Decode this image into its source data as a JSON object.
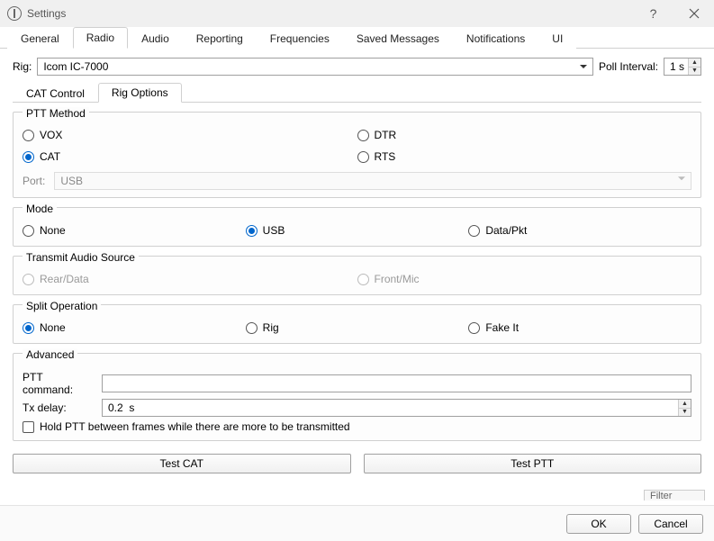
{
  "window": {
    "title": "Settings",
    "help_glyph": "?",
    "close_glyph": "✕"
  },
  "main_tabs": [
    "General",
    "Radio",
    "Audio",
    "Reporting",
    "Frequencies",
    "Saved Messages",
    "Notifications",
    "UI"
  ],
  "main_tab_active": 1,
  "rig": {
    "label": "Rig:",
    "value": "Icom IC-7000",
    "poll_label": "Poll Interval:",
    "poll_value": "1 s"
  },
  "sub_tabs": [
    "CAT Control",
    "Rig Options"
  ],
  "sub_tab_active": 1,
  "ptt_method": {
    "title": "PTT Method",
    "options": {
      "vox": "VOX",
      "cat": "CAT",
      "dtr": "DTR",
      "rts": "RTS"
    },
    "selected": "cat",
    "port_label": "Port:",
    "port_value": "USB"
  },
  "mode": {
    "title": "Mode",
    "options": {
      "none": "None",
      "usb": "USB",
      "data": "Data/Pkt"
    },
    "selected": "usb"
  },
  "tx_audio": {
    "title": "Transmit Audio Source",
    "options": {
      "rear": "Rear/Data",
      "front": "Front/Mic"
    },
    "enabled": false
  },
  "split": {
    "title": "Split Operation",
    "options": {
      "none": "None",
      "rig": "Rig",
      "fake": "Fake It"
    },
    "selected": "none"
  },
  "advanced": {
    "title": "Advanced",
    "ptt_cmd_label": "PTT command:",
    "ptt_cmd_value": "",
    "tx_delay_label": "Tx delay:",
    "tx_delay_value": "0.2  s",
    "hold_ptt_label": "Hold PTT between frames while there are more to be transmitted",
    "hold_ptt_checked": false
  },
  "test": {
    "cat": "Test CAT",
    "ptt": "Test PTT"
  },
  "footer": {
    "ok": "OK",
    "cancel": "Cancel"
  },
  "peek": {
    "filter": "Filter"
  }
}
